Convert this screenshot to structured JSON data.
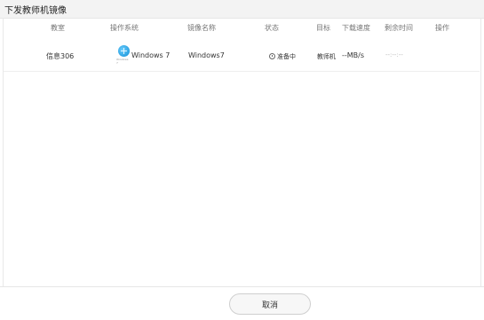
{
  "dialog": {
    "title": "下发教师机镜像"
  },
  "table": {
    "headers": {
      "classroom": "教室",
      "os": "操作系统",
      "image_name": "镜像名称",
      "status": "状态",
      "target": "目标",
      "download_speed": "下载速度",
      "remaining_time": "剩余时间",
      "actions": "操作"
    },
    "rows": [
      {
        "classroom": "信息306",
        "os_logo_text": "Windows 7",
        "os": "Windows 7",
        "image_name": "Windows7",
        "status": "准备中",
        "status_icon": "clock-icon",
        "target": "教师机",
        "download_speed": "--MB/s",
        "remaining_time": "--:--:--",
        "actions": ""
      }
    ]
  },
  "footer": {
    "cancel_label": "取消"
  },
  "colors": {
    "title_bar": "#f3f3f3",
    "os_logo": "#2aa0e0"
  }
}
